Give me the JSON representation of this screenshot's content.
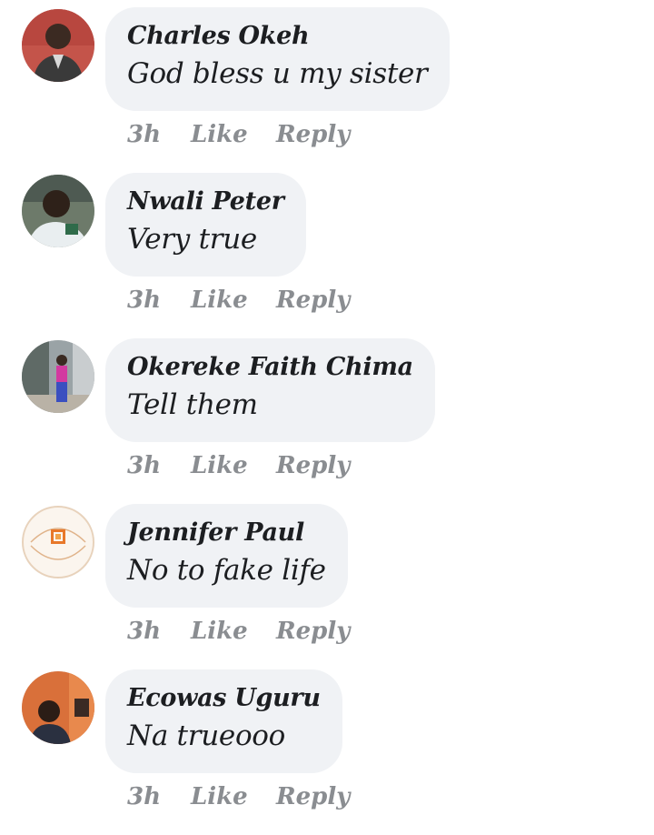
{
  "comments": [
    {
      "author": "Charles Okeh",
      "text": "God bless u my sister",
      "time": "3h",
      "like_label": "Like",
      "reply_label": "Reply",
      "avatar_icon": "profile-photo-man-red-background"
    },
    {
      "author": "Nwali Peter",
      "text": "Very true",
      "time": "3h",
      "like_label": "Like",
      "reply_label": "Reply",
      "avatar_icon": "profile-photo-man-white-shirt"
    },
    {
      "author": "Okereke Faith Chima",
      "text": "Tell them",
      "time": "3h",
      "like_label": "Like",
      "reply_label": "Reply",
      "avatar_icon": "profile-photo-woman-standing"
    },
    {
      "author": "Jennifer Paul",
      "text": "No to fake life",
      "time": "3h",
      "like_label": "Like",
      "reply_label": "Reply",
      "avatar_icon": "jennys-fashion-logo"
    },
    {
      "author": "Ecowas Uguru",
      "text": "Na trueooo",
      "time": "3h",
      "like_label": "Like",
      "reply_label": "Reply",
      "avatar_icon": "profile-photo-man-orange-room"
    }
  ],
  "colors": {
    "bubble_background": "#f0f2f5",
    "author_text": "#1c1e21",
    "meta_text": "#8a8d91"
  }
}
